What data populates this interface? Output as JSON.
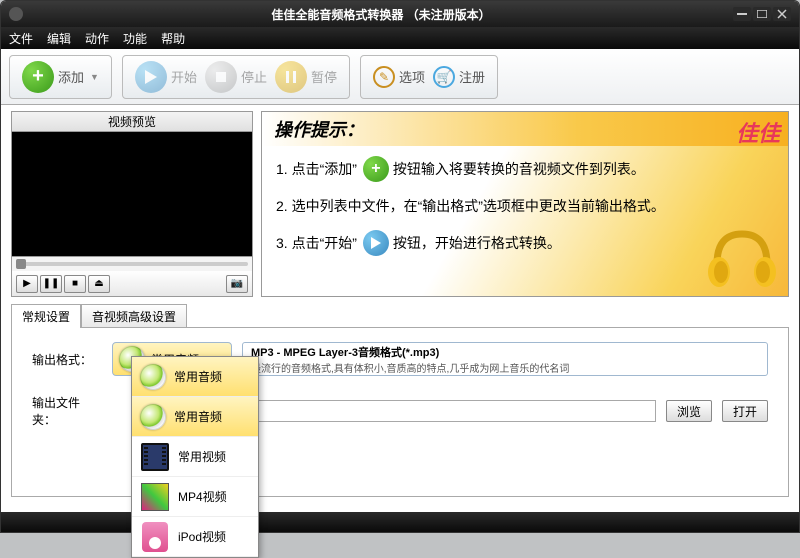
{
  "title": "佳佳全能音频格式转换器    （未注册版本）",
  "menu": {
    "file": "文件",
    "edit": "编辑",
    "action": "动作",
    "func": "功能",
    "help": "帮助"
  },
  "toolbar": {
    "add": "添加",
    "start": "开始",
    "stop": "停止",
    "pause": "暂停",
    "options": "选项",
    "register": "注册"
  },
  "preview": {
    "title": "视频预览"
  },
  "tips": {
    "header": "操作提示：",
    "brand": "佳佳",
    "l1a": "1. 点击“添加”",
    "l1b": "按钮输入将要转换的音视频文件到列表。",
    "l2": "2. 选中列表中文件，在“输出格式”选项框中更改当前输出格式。",
    "l3a": "3. 点击“开始”",
    "l3b": "按钮，开始进行格式转换。"
  },
  "tabs": {
    "basic": "常规设置",
    "adv": "音视频高级设置"
  },
  "settings": {
    "outfmt_label": "输出格式：",
    "outfolder_label": "输出文件夹：",
    "category": "常用音频",
    "format_name": "MP3 - MPEG Layer-3音频格式(*.mp3)",
    "format_desc": "最流行的音频格式,具有体积小,音质高的特点,几乎成为网上音乐的代名词",
    "browse": "浏览",
    "open": "打开"
  },
  "dropdown": {
    "audio": "常用音频",
    "video": "常用视频",
    "mp4": "MP4视频",
    "ipod": "iPod视频"
  }
}
